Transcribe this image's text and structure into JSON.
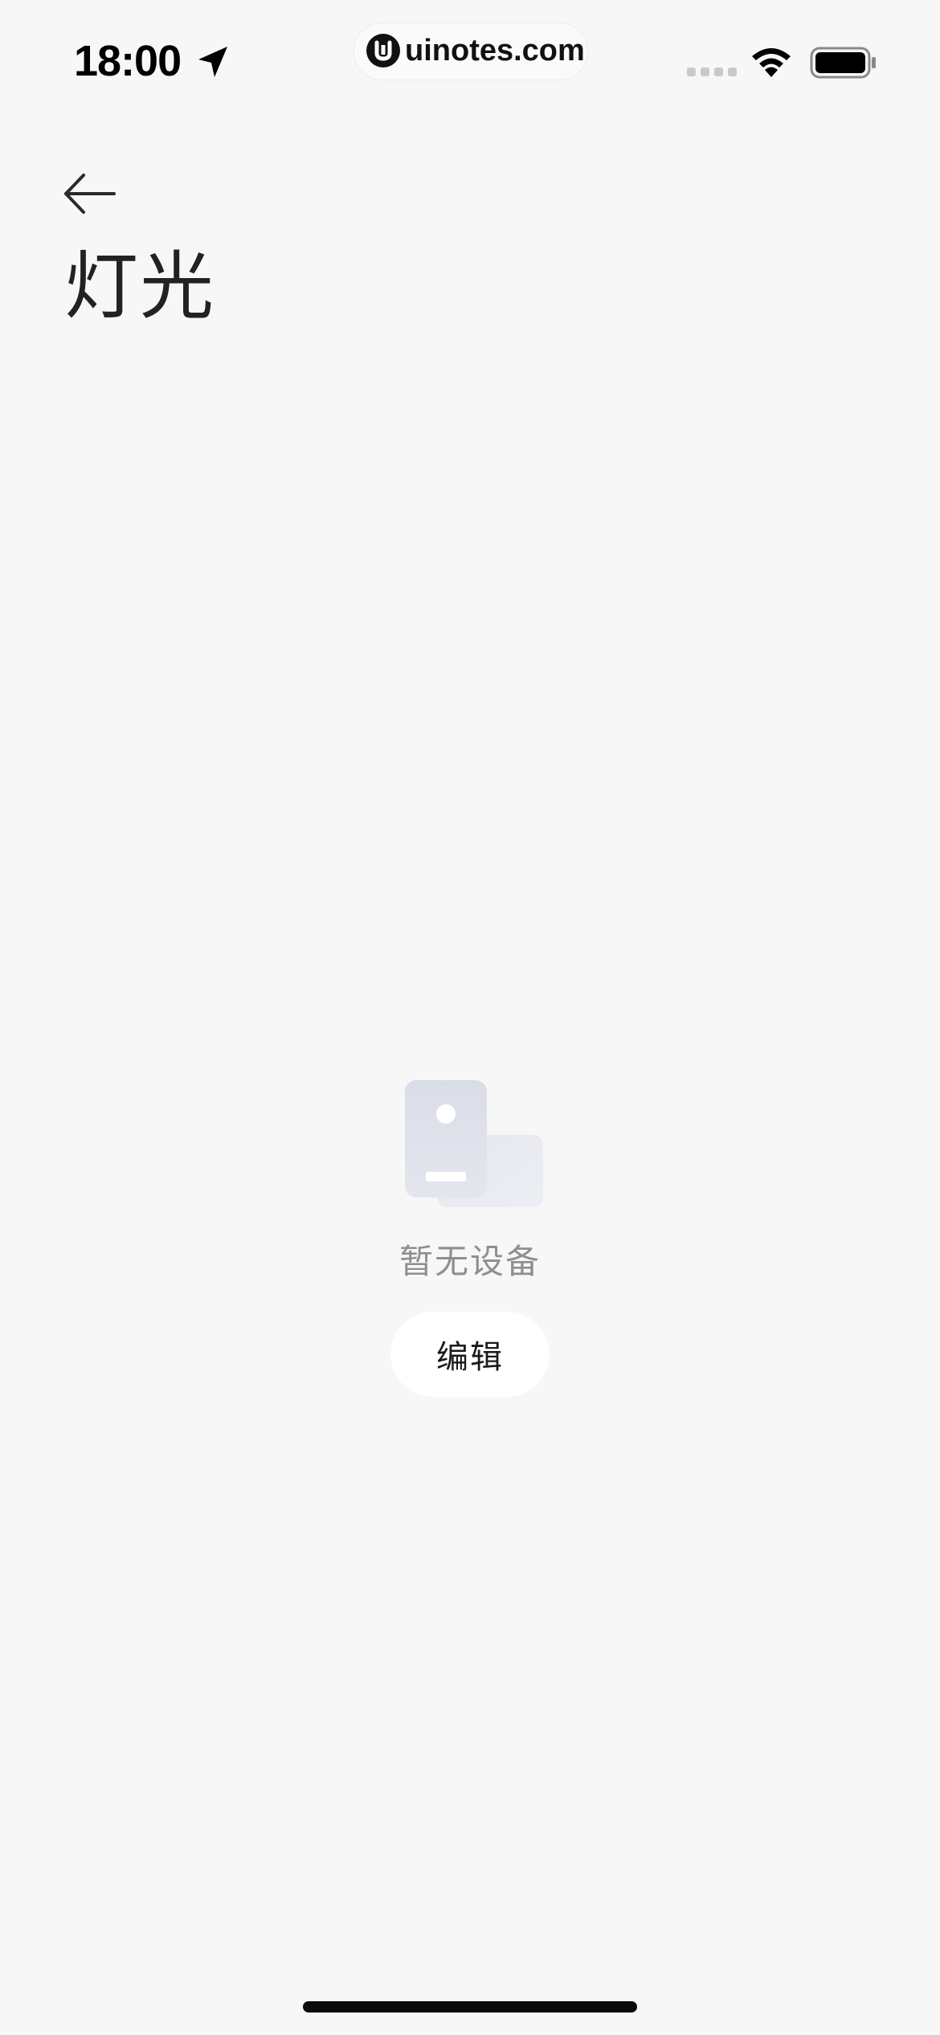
{
  "status_bar": {
    "time": "18:00",
    "watermark": "uinotes.com"
  },
  "header": {
    "title": "灯光"
  },
  "empty_state": {
    "message": "暂无设备",
    "edit_label": "编辑"
  },
  "colors": {
    "background": "#f7f7f7",
    "text_primary": "#222222",
    "text_secondary": "#8f8f8f",
    "button_bg": "#ffffff"
  }
}
